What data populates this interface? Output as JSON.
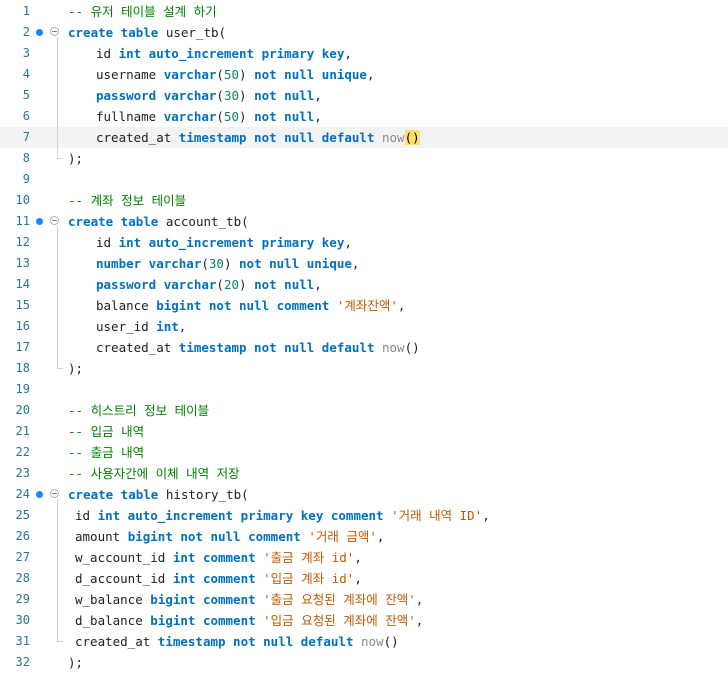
{
  "editor": {
    "lines": [
      {
        "n": "1",
        "parts": [
          {
            "t": "-- 유저 테이블 설계 하기",
            "c": "cm"
          }
        ]
      },
      {
        "n": "2",
        "bp": true,
        "fold": true,
        "parts": [
          {
            "t": "create table ",
            "c": "kw"
          },
          {
            "t": "user_tb(",
            "c": "id"
          }
        ]
      },
      {
        "n": "3",
        "ind": 2,
        "parts": [
          {
            "t": "id ",
            "c": "id"
          },
          {
            "t": "int auto_increment primary key",
            "c": "kw"
          },
          {
            "t": ",",
            "c": "id"
          }
        ]
      },
      {
        "n": "4",
        "ind": 2,
        "parts": [
          {
            "t": "username ",
            "c": "id"
          },
          {
            "t": "varchar",
            "c": "kw"
          },
          {
            "t": "(",
            "c": "id"
          },
          {
            "t": "50",
            "c": "num"
          },
          {
            "t": ") ",
            "c": "id"
          },
          {
            "t": "not null unique",
            "c": "kw"
          },
          {
            "t": ",",
            "c": "id"
          }
        ]
      },
      {
        "n": "5",
        "ind": 2,
        "parts": [
          {
            "t": "password varchar",
            "c": "kw"
          },
          {
            "t": "(",
            "c": "id"
          },
          {
            "t": "30",
            "c": "num"
          },
          {
            "t": ") ",
            "c": "id"
          },
          {
            "t": "not null",
            "c": "kw"
          },
          {
            "t": ",",
            "c": "id"
          }
        ]
      },
      {
        "n": "6",
        "ind": 2,
        "parts": [
          {
            "t": "fullname ",
            "c": "id"
          },
          {
            "t": "varchar",
            "c": "kw"
          },
          {
            "t": "(",
            "c": "id"
          },
          {
            "t": "50",
            "c": "num"
          },
          {
            "t": ") ",
            "c": "id"
          },
          {
            "t": "not null",
            "c": "kw"
          },
          {
            "t": ",",
            "c": "id"
          }
        ]
      },
      {
        "n": "7",
        "ind": 2,
        "cur": true,
        "parts": [
          {
            "t": "created_at ",
            "c": "id"
          },
          {
            "t": "timestamp not null default ",
            "c": "kw"
          },
          {
            "t": "now",
            "c": "nowf"
          },
          {
            "t": "()",
            "c": "hl"
          }
        ]
      },
      {
        "n": "8",
        "parts": [
          {
            "t": ");",
            "c": "id"
          }
        ]
      },
      {
        "n": "9",
        "parts": []
      },
      {
        "n": "10",
        "parts": [
          {
            "t": "-- 계좌 정보 테이블",
            "c": "cm"
          }
        ]
      },
      {
        "n": "11",
        "bp": true,
        "fold": true,
        "parts": [
          {
            "t": "create table ",
            "c": "kw"
          },
          {
            "t": "account_tb(",
            "c": "id"
          }
        ]
      },
      {
        "n": "12",
        "ind": 2,
        "parts": [
          {
            "t": "id ",
            "c": "id"
          },
          {
            "t": "int auto_increment primary key",
            "c": "kw"
          },
          {
            "t": ",",
            "c": "id"
          }
        ]
      },
      {
        "n": "13",
        "ind": 2,
        "parts": [
          {
            "t": "number varchar",
            "c": "kw"
          },
          {
            "t": "(",
            "c": "id"
          },
          {
            "t": "30",
            "c": "num"
          },
          {
            "t": ") ",
            "c": "id"
          },
          {
            "t": "not null unique",
            "c": "kw"
          },
          {
            "t": ",",
            "c": "id"
          }
        ]
      },
      {
        "n": "14",
        "ind": 2,
        "parts": [
          {
            "t": "password varchar",
            "c": "kw"
          },
          {
            "t": "(",
            "c": "id"
          },
          {
            "t": "20",
            "c": "num"
          },
          {
            "t": ") ",
            "c": "id"
          },
          {
            "t": "not null",
            "c": "kw"
          },
          {
            "t": ",",
            "c": "id"
          }
        ]
      },
      {
        "n": "15",
        "ind": 2,
        "parts": [
          {
            "t": "balance ",
            "c": "id"
          },
          {
            "t": "bigint not null comment ",
            "c": "kw"
          },
          {
            "t": "'계좌잔액'",
            "c": "str"
          },
          {
            "t": ",",
            "c": "id"
          }
        ]
      },
      {
        "n": "16",
        "ind": 2,
        "parts": [
          {
            "t": "user_id ",
            "c": "id"
          },
          {
            "t": "int",
            "c": "kw"
          },
          {
            "t": ",",
            "c": "id"
          }
        ]
      },
      {
        "n": "17",
        "ind": 2,
        "parts": [
          {
            "t": "created_at ",
            "c": "id"
          },
          {
            "t": "timestamp not null default ",
            "c": "kw"
          },
          {
            "t": "now",
            "c": "nowf"
          },
          {
            "t": "()",
            "c": "id"
          }
        ]
      },
      {
        "n": "18",
        "parts": [
          {
            "t": ");",
            "c": "id"
          }
        ]
      },
      {
        "n": "19",
        "parts": []
      },
      {
        "n": "20",
        "parts": [
          {
            "t": "-- 히스트리 정보 테이블",
            "c": "cm"
          }
        ]
      },
      {
        "n": "21",
        "parts": [
          {
            "t": "-- 입금 내역",
            "c": "cm"
          }
        ]
      },
      {
        "n": "22",
        "parts": [
          {
            "t": "-- 출금 내역",
            "c": "cm"
          }
        ]
      },
      {
        "n": "23",
        "parts": [
          {
            "t": "-- 사용자간에 이체 내역 저장",
            "c": "cm"
          }
        ]
      },
      {
        "n": "24",
        "bp": true,
        "fold": true,
        "parts": [
          {
            "t": "create table ",
            "c": "kw"
          },
          {
            "t": "history_tb(",
            "c": "id"
          }
        ]
      },
      {
        "n": "25",
        "ind": 1,
        "parts": [
          {
            "t": "id ",
            "c": "id"
          },
          {
            "t": "int auto_increment primary key comment ",
            "c": "kw"
          },
          {
            "t": "'거래 내역 ID'",
            "c": "str"
          },
          {
            "t": ",",
            "c": "id"
          }
        ]
      },
      {
        "n": "26",
        "ind": 1,
        "parts": [
          {
            "t": "amount ",
            "c": "id"
          },
          {
            "t": "bigint not null comment ",
            "c": "kw"
          },
          {
            "t": "'거래 금액'",
            "c": "str"
          },
          {
            "t": ",",
            "c": "id"
          }
        ]
      },
      {
        "n": "27",
        "ind": 1,
        "parts": [
          {
            "t": "w_account_id ",
            "c": "id"
          },
          {
            "t": "int comment ",
            "c": "kw"
          },
          {
            "t": "'출금 계좌 id'",
            "c": "str"
          },
          {
            "t": ",",
            "c": "id"
          }
        ]
      },
      {
        "n": "28",
        "ind": 1,
        "parts": [
          {
            "t": "d_account_id ",
            "c": "id"
          },
          {
            "t": "int comment ",
            "c": "kw"
          },
          {
            "t": "'입금 계좌 id'",
            "c": "str"
          },
          {
            "t": ",",
            "c": "id"
          }
        ]
      },
      {
        "n": "29",
        "ind": 1,
        "parts": [
          {
            "t": "w_balance ",
            "c": "id"
          },
          {
            "t": "bigint comment ",
            "c": "kw"
          },
          {
            "t": "'출금 요청된 계좌에 잔액'",
            "c": "str"
          },
          {
            "t": ",",
            "c": "id"
          }
        ]
      },
      {
        "n": "30",
        "ind": 1,
        "parts": [
          {
            "t": "d_balance ",
            "c": "id"
          },
          {
            "t": "bigint comment ",
            "c": "kw"
          },
          {
            "t": "'입금 요청된 계좌에 잔액'",
            "c": "str"
          },
          {
            "t": ",",
            "c": "id"
          }
        ]
      },
      {
        "n": "31",
        "ind": 1,
        "parts": [
          {
            "t": "created_at ",
            "c": "id"
          },
          {
            "t": "timestamp not null default ",
            "c": "kw"
          },
          {
            "t": "now",
            "c": "nowf"
          },
          {
            "t": "()",
            "c": "id"
          }
        ]
      },
      {
        "n": "32",
        "parts": [
          {
            "t": ");",
            "c": "id"
          }
        ]
      }
    ]
  }
}
